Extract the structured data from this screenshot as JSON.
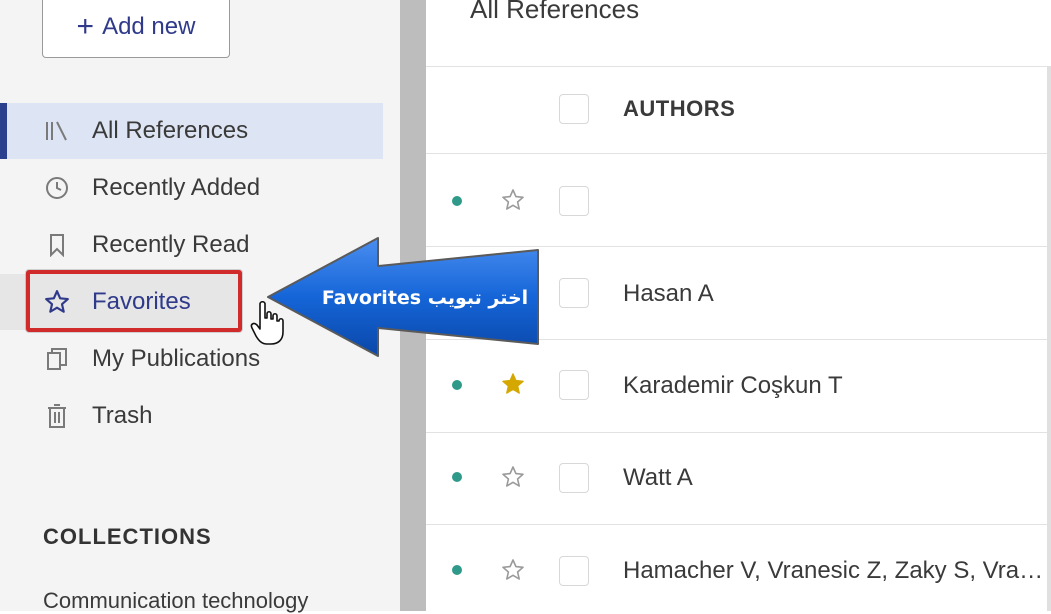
{
  "sidebar": {
    "add_new_label": "Add new",
    "nav_items": [
      {
        "label": "All References",
        "icon": "library-icon",
        "active": true
      },
      {
        "label": "Recently Added",
        "icon": "clock-icon",
        "active": false
      },
      {
        "label": "Recently Read",
        "icon": "bookmark-icon",
        "active": false
      },
      {
        "label": "Favorites",
        "icon": "star-icon",
        "active": false
      },
      {
        "label": "My Publications",
        "icon": "publications-icon",
        "active": false
      },
      {
        "label": "Trash",
        "icon": "trash-icon",
        "active": false
      }
    ],
    "collections_title": "COLLECTIONS",
    "collections": [
      {
        "label": "Communication technology"
      }
    ]
  },
  "main": {
    "title": "All References",
    "table": {
      "header": {
        "authors": "AUTHORS"
      },
      "rows": [
        {
          "author": "",
          "favorite": false,
          "unread": true
        },
        {
          "author": "Hasan A",
          "favorite": false,
          "unread": true
        },
        {
          "author": "Karademir Coşkun T",
          "favorite": true,
          "unread": true
        },
        {
          "author": "Watt A",
          "favorite": false,
          "unread": true
        },
        {
          "author": "Hamacher V, Vranesic Z, Zaky S, Vra…",
          "favorite": false,
          "unread": true
        }
      ]
    }
  },
  "callout": {
    "text": "اختر تبويب Favorites"
  },
  "colors": {
    "accent": "#2a3f8e",
    "highlight_border": "#d12a2a",
    "unread_dot": "#2f9a8a",
    "favorite_star": "#d4a800",
    "callout_blue": "#1565d8"
  }
}
